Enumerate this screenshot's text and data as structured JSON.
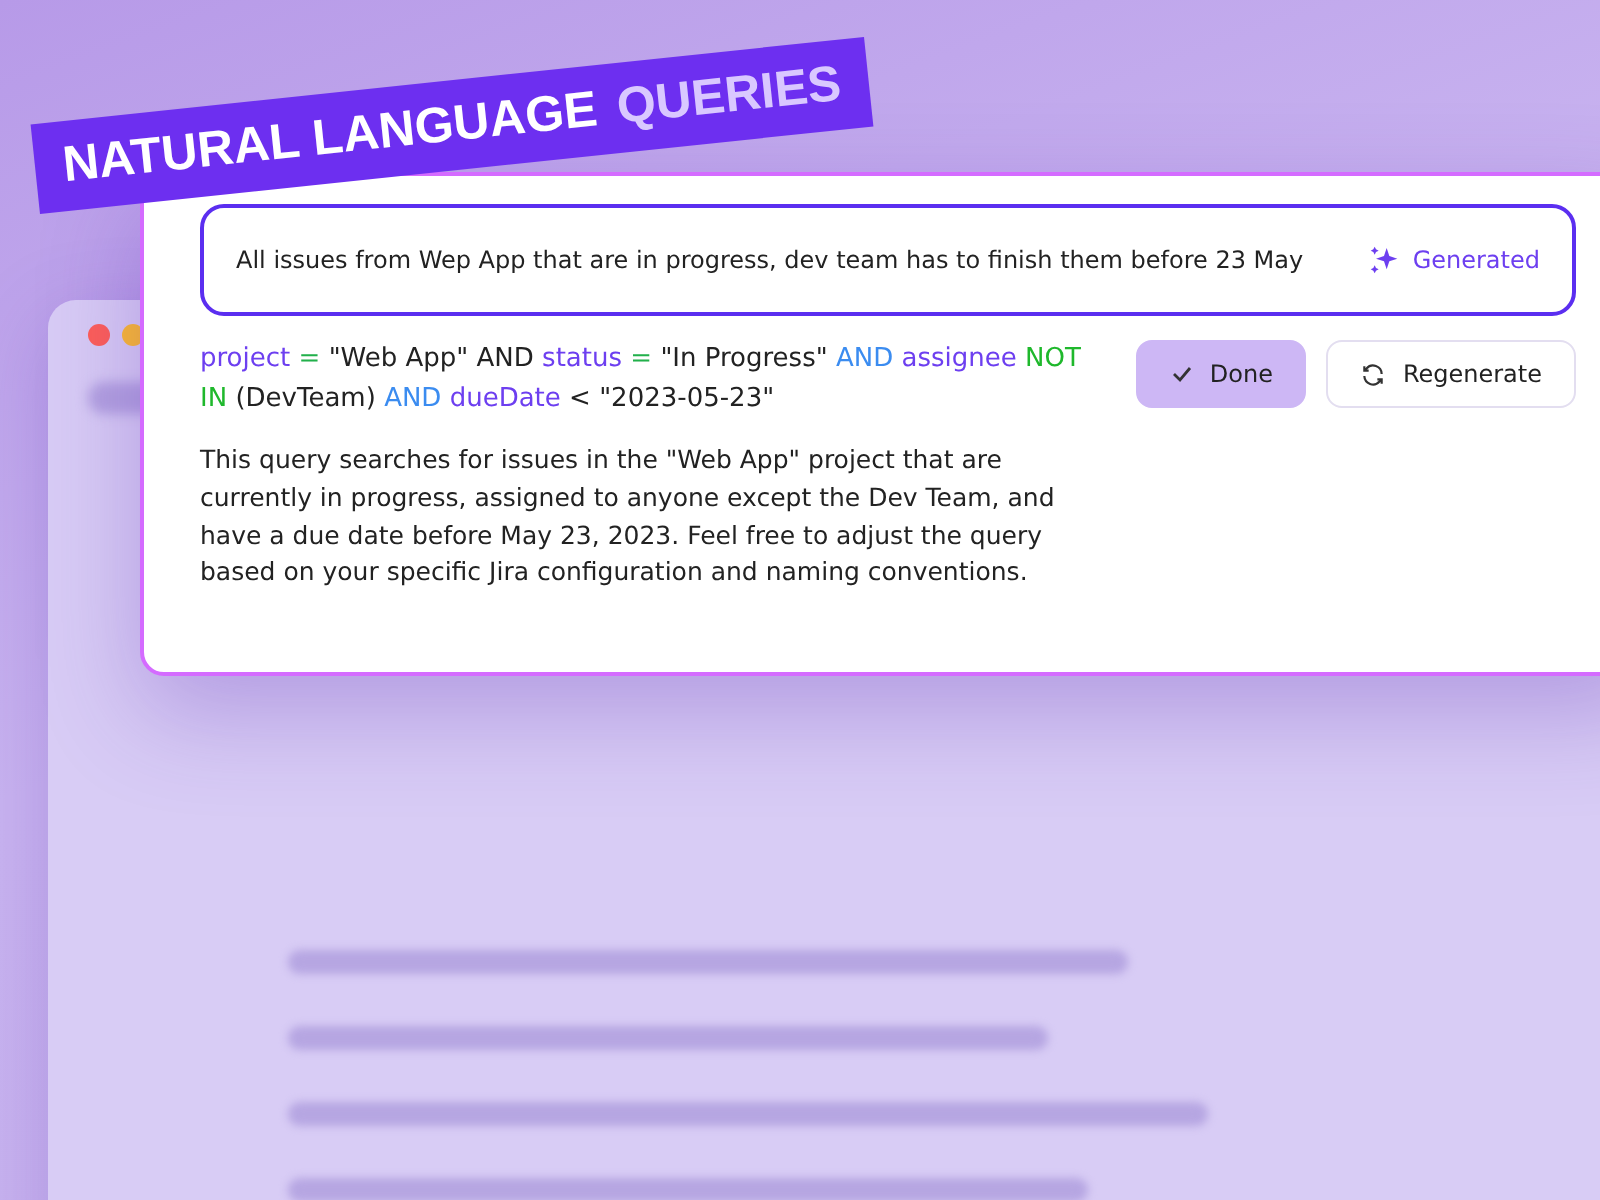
{
  "banner": {
    "words": [
      {
        "text": "NATURAL LANGUAGE",
        "kind": "main"
      },
      {
        "text": "QUERIES",
        "kind": "accent"
      }
    ]
  },
  "prompt": {
    "value": "All issues from Wep App that are in progress, dev team has to finish them before 23 May",
    "badge": "Generated"
  },
  "query": [
    {
      "text": "project",
      "kind": "field"
    },
    {
      "text": "=",
      "kind": "operator"
    },
    {
      "text": "\"Web App\" AND",
      "kind": "text"
    },
    {
      "text": "status",
      "kind": "field"
    },
    {
      "text": "=",
      "kind": "operator"
    },
    {
      "text": "\"In Progress\"",
      "kind": "text"
    },
    {
      "text": "AND",
      "kind": "keyword"
    },
    {
      "text": "assignee",
      "kind": "field"
    },
    {
      "text": "NOT IN",
      "kind": "negation"
    },
    {
      "text": "(DevTeam)",
      "kind": "text"
    },
    {
      "text": "AND",
      "kind": "keyword"
    },
    {
      "text": "dueDate",
      "kind": "field"
    },
    {
      "text": "< \"2023-05-23\"",
      "kind": "text"
    }
  ],
  "explanation": "This query searches for issues in the \"Web App\" project that are currently in progress, assigned to anyone except the Dev Team, and have a due date before May 23, 2023. Feel free to adjust the query based on your specific Jira configuration and naming conventions.",
  "buttons": [
    {
      "label": "Done",
      "kind": "primary"
    },
    {
      "label": "Regenerate",
      "kind": "secondary"
    }
  ]
}
